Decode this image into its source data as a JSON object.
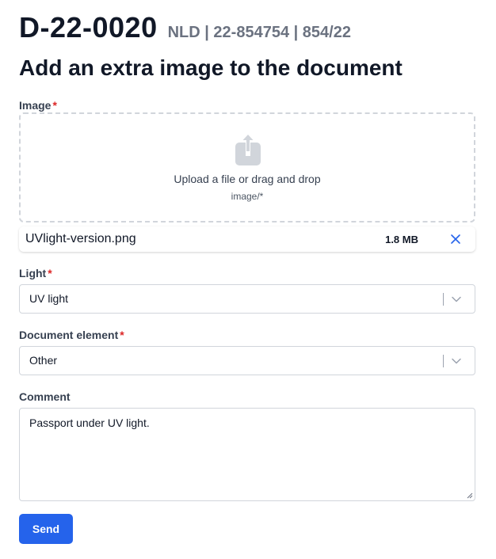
{
  "header": {
    "document_id": "D-22-0020",
    "meta": "NLD | 22-854754 | 854/22"
  },
  "page_title": "Add an extra image to the document",
  "image_field": {
    "label": "Image",
    "required_mark": "*",
    "upload_text": "Upload a file or drag and drop",
    "accept_hint": "image/*",
    "icon": "upload-icon"
  },
  "uploaded_file": {
    "name": "UVlight-version.png",
    "size": "1.8 MB",
    "remove_icon": "close-icon"
  },
  "light_field": {
    "label": "Light",
    "required_mark": "*",
    "value": "UV light"
  },
  "document_element_field": {
    "label": "Document element",
    "required_mark": "*",
    "value": "Other"
  },
  "comment_field": {
    "label": "Comment",
    "value": "Passport under UV light."
  },
  "send_button": {
    "label": "Send"
  },
  "colors": {
    "primary": "#2563eb",
    "required": "#dc2626",
    "meta_text": "#6b7280",
    "border": "#d1d5db"
  }
}
